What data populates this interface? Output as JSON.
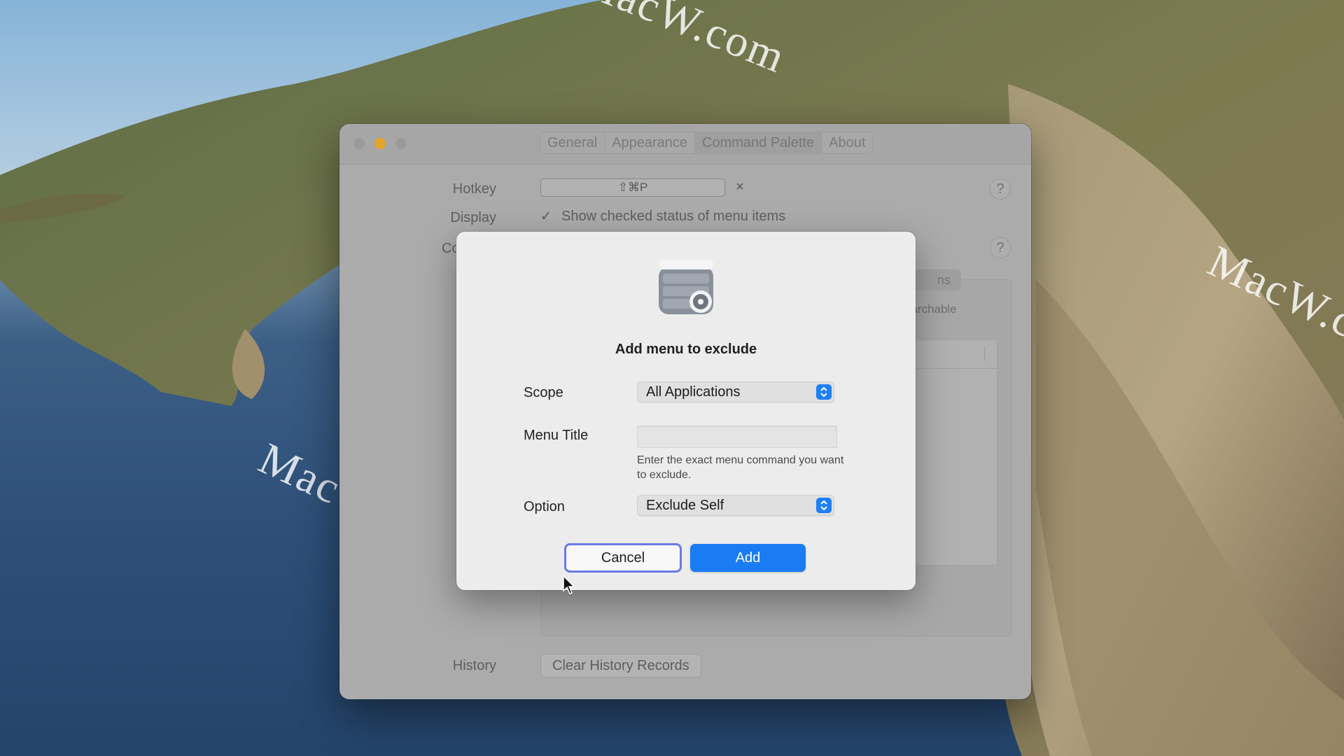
{
  "wallpaper": {
    "watermarks": [
      "MacW.com",
      "MacW.com",
      "MacW.c"
    ]
  },
  "window": {
    "tabs": [
      {
        "label": "General",
        "active": false
      },
      {
        "label": "Appearance",
        "active": false
      },
      {
        "label": "Command Palette",
        "active": true
      },
      {
        "label": "About",
        "active": false
      }
    ],
    "hotkey": {
      "label": "Hotkey",
      "value": "⇧⌘P",
      "clear_icon": "×"
    },
    "display": {
      "label": "Display",
      "checkbox_label": "Show checked status of menu items",
      "checked": true
    },
    "partial_row_label": "Co",
    "partial_pill_text": "ns",
    "partial_searchable_text": "l searchable",
    "help_icon": "?",
    "history": {
      "label": "History",
      "button": "Clear History Records"
    }
  },
  "sheet": {
    "title": "Add menu to exclude",
    "scope": {
      "label": "Scope",
      "value": "All Applications"
    },
    "menu_title": {
      "label": "Menu Title",
      "value": "",
      "hint": "Enter the exact menu command you want to exclude."
    },
    "option": {
      "label": "Option",
      "value": "Exclude Self"
    },
    "cancel": "Cancel",
    "add": "Add"
  },
  "colors": {
    "accent": "#1a7cf2",
    "focus_ring": "#6a7ae6",
    "traffic_yellow": "#e4a52a"
  }
}
